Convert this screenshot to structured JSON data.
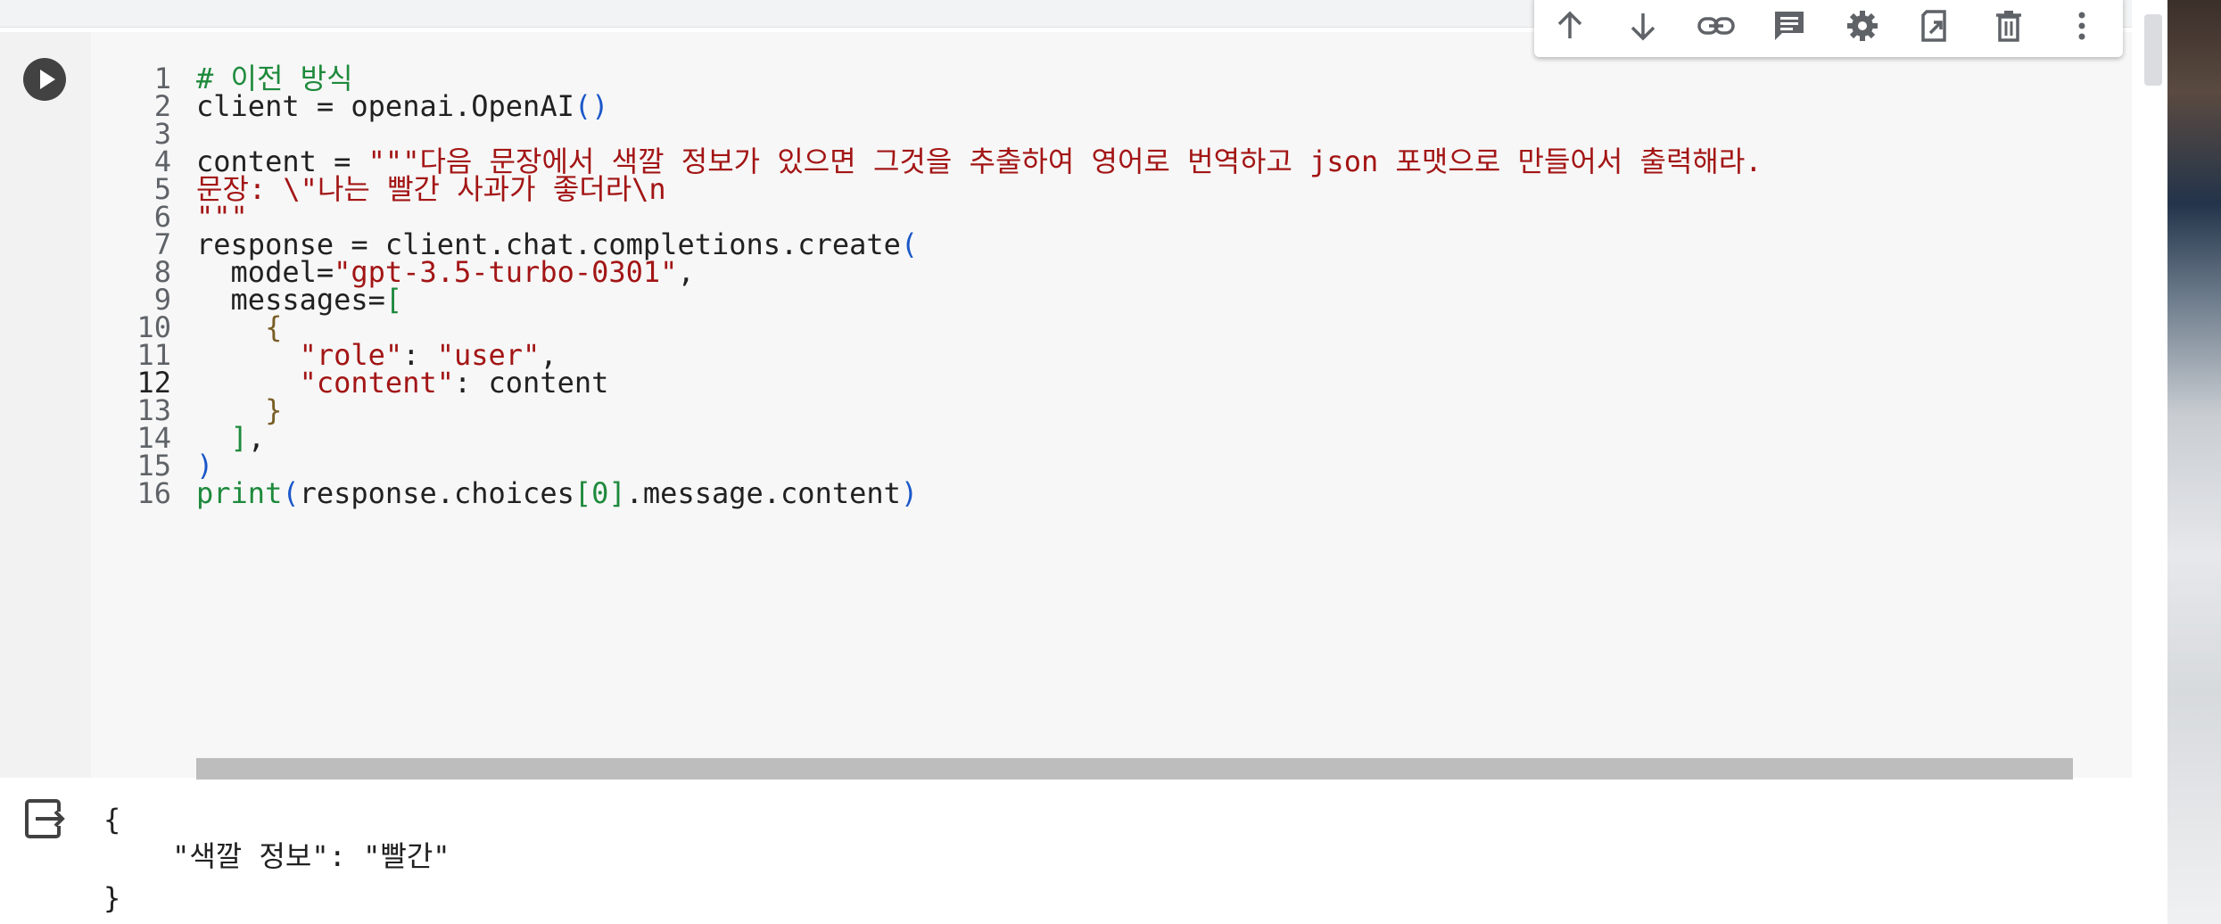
{
  "toolbar": {
    "items": [
      "move-cell-up",
      "move-cell-down",
      "copy-link",
      "add-comment",
      "open-settings",
      "mirror-cell",
      "delete-cell",
      "more-actions"
    ]
  },
  "cell": {
    "line_numbers": [
      "1",
      "2",
      "3",
      "4",
      "5",
      "6",
      "7",
      "8",
      "9",
      "10",
      "11",
      "12",
      "13",
      "14",
      "15",
      "16"
    ],
    "active_line": "12",
    "code": {
      "l1": "# 이전 방식",
      "l2_a": "client = openai.OpenAI",
      "l2_b": "()",
      "l4_a": "content = ",
      "l4_b": "\"\"\"다음 문장에서 색깔 정보가 있으면 그것을 추출하여 영어로 번역하고 json 포맷으로 만들어서 출력해라.",
      "l5": "문장: \\\"나는 빨간 사과가 좋더라\\n",
      "l6": "\"\"\"",
      "l7_a": "response = client.chat.completions.create",
      "l7_b": "(",
      "l8_a": "  model=",
      "l8_b": "\"gpt-3.5-turbo-0301\"",
      "l8_c": ",",
      "l9_a": "  messages=",
      "l9_b": "[",
      "l10": "    {",
      "l11_a": "      ",
      "l11_b": "\"role\"",
      "l11_c": ": ",
      "l11_d": "\"user\"",
      "l11_e": ",",
      "l12_a": "      ",
      "l12_b": "\"content\"",
      "l12_c": ": content",
      "l13": "    }",
      "l14_a": "  ",
      "l14_b": "]",
      "l14_c": ",",
      "l15": ")",
      "l16_a": "print",
      "l16_b": "(",
      "l16_c": "response.choices",
      "l16_d": "[0]",
      "l16_e": ".message.content",
      "l16_f": ")"
    }
  },
  "output": {
    "lines": [
      "{",
      "    \"색깔 정보\": \"빨간\"",
      "}"
    ]
  },
  "colors": {
    "comment": "#1e8a3c",
    "string": "#a31515",
    "bracket": "#1a57c9"
  }
}
